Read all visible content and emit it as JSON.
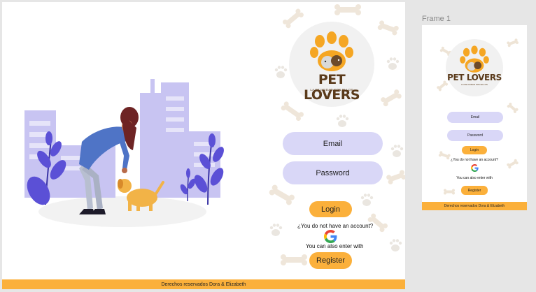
{
  "main": {
    "brand_name": "PET LOVERS",
    "brand_tagline": "LA FELICIDAD SON ELLOS",
    "email_label": "Email",
    "password_label": "Password",
    "login_label": "Login",
    "no_account_text": "¿You do not have an account?",
    "also_enter_text": "You can also enter with",
    "register_label": "Register",
    "footer_text": "Derechos reservados Dora & Elizabeth"
  },
  "frame_label": "Frame 1",
  "mini": {
    "brand_name": "PET LOVERS",
    "brand_tagline": "LA FELICIDAD SON ELLOS",
    "email_label": "Email",
    "password_label": "Password",
    "login_label": "Login",
    "no_account_text": "¿You do not have an account?",
    "also_enter_text": "You can also enter with",
    "register_label": "Register",
    "footer_text": "Derechos reservados Dora & Elizabeth"
  },
  "colors": {
    "accent": "#fbb03b",
    "pill": "#d9d7f7",
    "brand_brown": "#5a3a1a",
    "illustration_purple": "#c8c4f2",
    "leaf_purple": "#5b50d6"
  },
  "icons": [
    "google-icon",
    "paw-icon",
    "bone-icon",
    "cat-dog-logo-icon"
  ]
}
